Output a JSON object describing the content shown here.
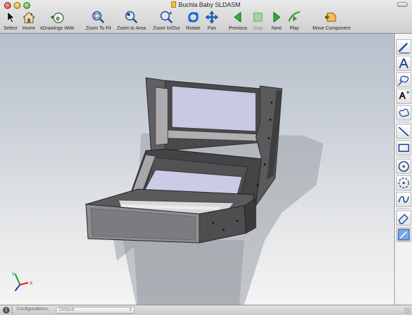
{
  "window": {
    "title": "Buchla Baby SLDASM"
  },
  "toolbar": {
    "tools": [
      {
        "id": "select",
        "label": "Select",
        "icon": "arrow-cursor-icon",
        "enabled": true
      },
      {
        "id": "home",
        "label": "Home",
        "icon": "home-icon",
        "enabled": true
      },
      {
        "id": "edrawings-web",
        "label": "eDrawings Web",
        "icon": "edrawings-web-icon",
        "enabled": true
      },
      {
        "id": "zoom-to-fit",
        "label": "Zoom To Fit",
        "icon": "zoom-to-fit-icon",
        "enabled": true
      },
      {
        "id": "zoom-to-area",
        "label": "Zoom to Area",
        "icon": "zoom-to-area-icon",
        "enabled": true
      },
      {
        "id": "zoom-in-out",
        "label": "Zoom In/Out",
        "icon": "zoom-in-out-icon",
        "enabled": true
      },
      {
        "id": "rotate",
        "label": "Rotate",
        "icon": "rotate-icon",
        "enabled": true
      },
      {
        "id": "pan",
        "label": "Pan",
        "icon": "pan-icon",
        "enabled": true
      },
      {
        "id": "previous",
        "label": "Previous",
        "icon": "previous-icon",
        "enabled": true
      },
      {
        "id": "stop",
        "label": "Stop",
        "icon": "stop-icon",
        "enabled": false
      },
      {
        "id": "next",
        "label": "Next",
        "icon": "next-icon",
        "enabled": true
      },
      {
        "id": "play",
        "label": "Play",
        "icon": "play-icon",
        "enabled": true
      },
      {
        "id": "move-component",
        "label": "Move Component",
        "icon": "move-component-icon",
        "enabled": true
      }
    ]
  },
  "sidebar": {
    "tools": [
      {
        "id": "markup-pen",
        "icon": "markup-pen-icon"
      },
      {
        "id": "text",
        "icon": "text-icon"
      },
      {
        "id": "cloud-leader",
        "icon": "cloud-leader-icon"
      },
      {
        "id": "text-with-leader",
        "icon": "text-leader-icon"
      },
      {
        "id": "cloud",
        "icon": "cloud-icon"
      },
      {
        "id": "line",
        "icon": "line-icon"
      },
      {
        "id": "rectangle",
        "icon": "rectangle-icon"
      },
      {
        "id": "circle",
        "icon": "circle-icon"
      },
      {
        "id": "circle-dashed",
        "icon": "circle-dashed-icon"
      },
      {
        "id": "spline",
        "icon": "spline-icon"
      },
      {
        "id": "eraser",
        "icon": "eraser-icon"
      },
      {
        "id": "stamp",
        "icon": "stamp-icon"
      }
    ]
  },
  "statusbar": {
    "configurations_label": "Configurations:",
    "configuration_value": "Default"
  },
  "triad": {
    "y_label": "Y",
    "x_label": "X"
  },
  "colors": {
    "model_body": "#5a5a5a",
    "model_panel": "#c9cbe4",
    "viewport_top": "#b6bfcb",
    "viewport_bottom": "#f4f4f4"
  }
}
